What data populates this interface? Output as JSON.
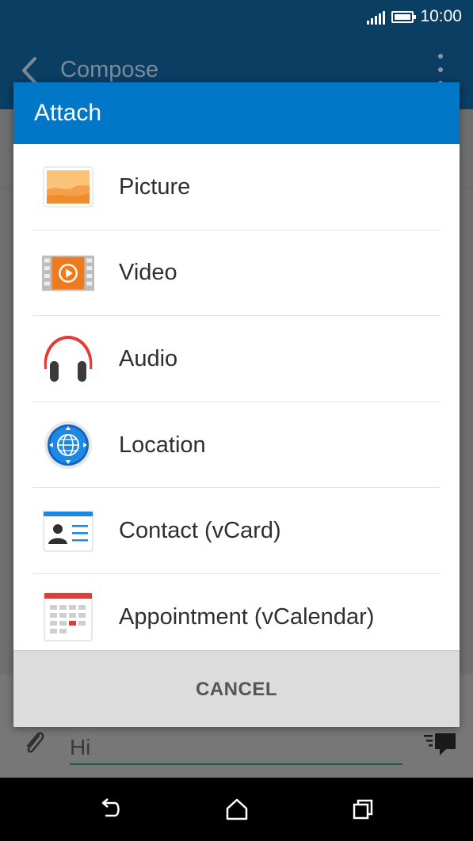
{
  "status_bar": {
    "time": "10:00"
  },
  "app_bar": {
    "title": "Compose"
  },
  "compose": {
    "message_text": "Hi"
  },
  "dialog": {
    "title": "Attach",
    "options": [
      {
        "label": "Picture",
        "icon": "picture-icon"
      },
      {
        "label": "Video",
        "icon": "video-icon"
      },
      {
        "label": "Audio",
        "icon": "headphones-icon"
      },
      {
        "label": "Location",
        "icon": "globe-location-icon"
      },
      {
        "label": "Contact (vCard)",
        "icon": "contact-card-icon"
      },
      {
        "label": "Appointment (vCalendar)",
        "icon": "calendar-icon"
      }
    ],
    "cancel_label": "CANCEL"
  },
  "colors": {
    "header_blue": "#0276c7",
    "status_bar": "#0a3e63",
    "dim_background": "#6f6f6f"
  }
}
